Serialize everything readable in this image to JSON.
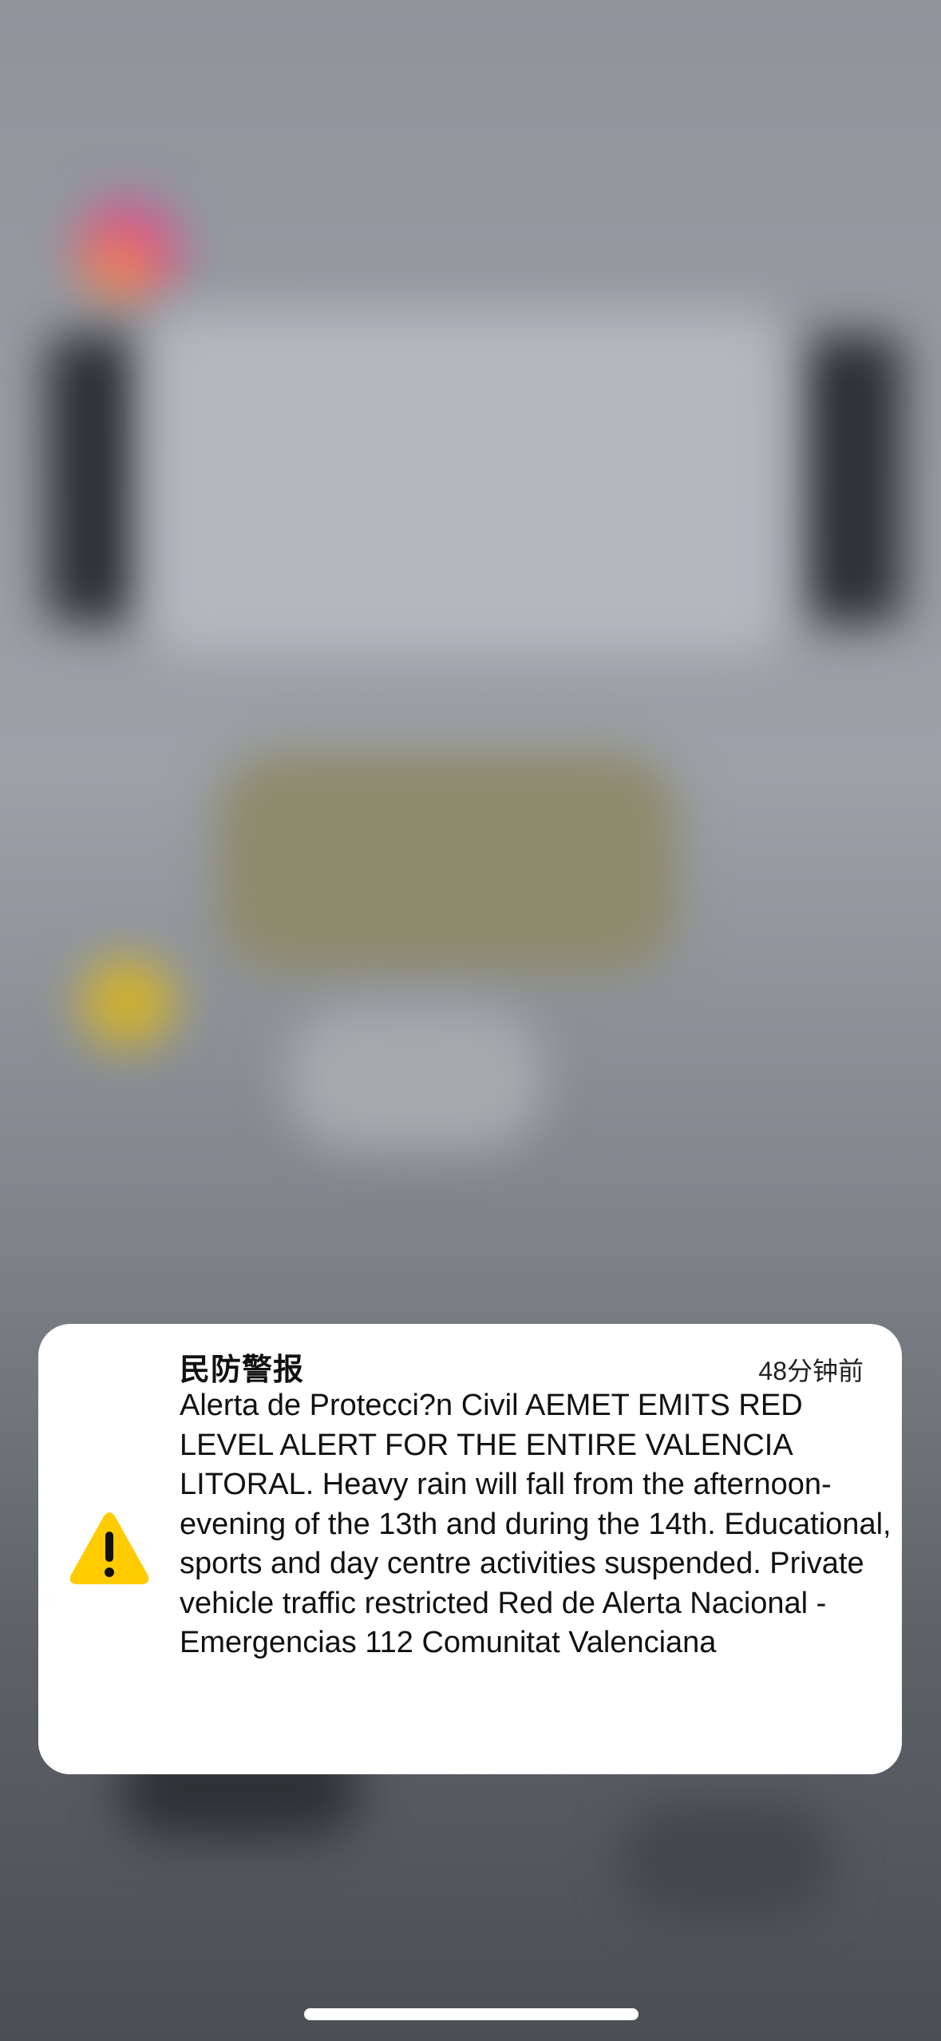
{
  "notification": {
    "title": "民防警报",
    "time": "48分钟前",
    "body": "Alerta de Protecci?n Civil AEMET EMITS RED LEVEL ALERT FOR THE ENTIRE VALENCIA LITORAL. Heavy rain will fall from the afternoon-evening of the 13th and during the 14th. Educational, sports and day centre activities suspended. Private vehicle traffic restricted Red de Alerta Nacional - Emergencias 112 Comunitat Valenciana",
    "icon": "warning-triangle-icon",
    "icon_color": "#FFCC00"
  }
}
